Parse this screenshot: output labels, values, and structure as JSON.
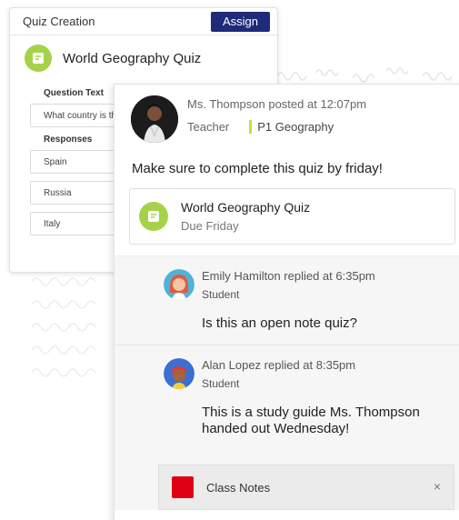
{
  "quiz_creation": {
    "header_title": "Quiz Creation",
    "assign_label": "Assign",
    "quiz_title": "World Geography Quiz",
    "question_label": "Question Text",
    "question_value": "What country is th",
    "responses_label": "Responses",
    "responses": [
      "Spain",
      "Russia",
      "Italy"
    ]
  },
  "post": {
    "author_line": "Ms. Thompson posted at 12:07pm",
    "role": "Teacher",
    "class_tag": "P1 Geography",
    "message": "Make sure to complete this quiz by friday!",
    "attachment": {
      "title": "World Geography Quiz",
      "due": "Due Friday"
    }
  },
  "replies": [
    {
      "author_line": "Emily Hamilton replied at 6:35pm",
      "role": "Student",
      "text": "Is this an open note quiz?"
    },
    {
      "author_line": "Alan Lopez replied at 8:35pm",
      "role": "Student",
      "text": "This is a study guide Ms. Thompson handed out Wednesday!"
    }
  ],
  "file_attachment": {
    "label": "Class Notes",
    "close_glyph": "×"
  },
  "colors": {
    "assign_button": "#1f2a7a",
    "quiz_icon": "#a6d24a",
    "class_tag_bar": "#cddc39",
    "file_icon": "#e00016"
  }
}
